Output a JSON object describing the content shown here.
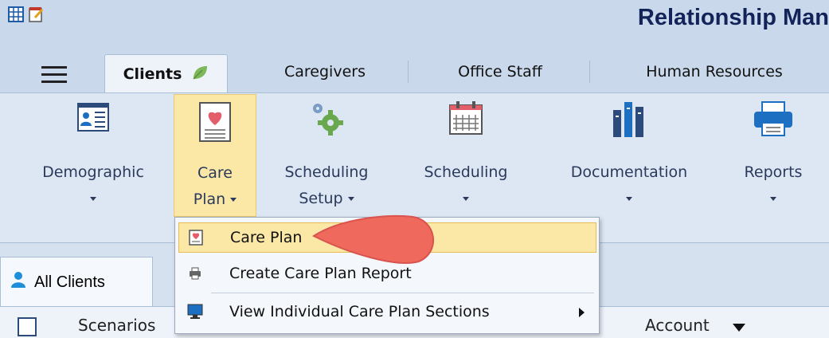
{
  "app": {
    "title": "Relationship Man"
  },
  "tabs": [
    "Clients",
    "Caregivers",
    "Office Staff",
    "Human Resources"
  ],
  "ribbon": {
    "demographic": {
      "label": "Demographic"
    },
    "care_plan": {
      "line1": "Care",
      "line2": "Plan"
    },
    "scheduling_setup": {
      "line1": "Scheduling",
      "line2": "Setup"
    },
    "scheduling": {
      "label": "Scheduling"
    },
    "documentation": {
      "label": "Documentation"
    },
    "reports": {
      "label": "Reports"
    }
  },
  "menu": {
    "items": [
      "Care Plan",
      "Create Care Plan Report",
      "View Individual Care Plan Sections"
    ]
  },
  "lower": {
    "tab_label": "All Clients",
    "toolbar": {
      "scenarios": "Scenarios",
      "account": "Account"
    }
  },
  "colors": {
    "title": "#12235a",
    "selected_button": "#fbe8a6",
    "pointer": "#ef6a5c",
    "ribbon_background": "#dde7f3"
  },
  "icons": {
    "quick_access": [
      "grid-icon",
      "notepad-icon"
    ],
    "ribbon": [
      "contact-card-icon",
      "heart-document-icon",
      "gears-icon",
      "calendar-icon",
      "books-icon",
      "printer-icon"
    ],
    "menu": [
      "heart-document-icon",
      "printer-icon",
      "monitor-icon"
    ]
  }
}
